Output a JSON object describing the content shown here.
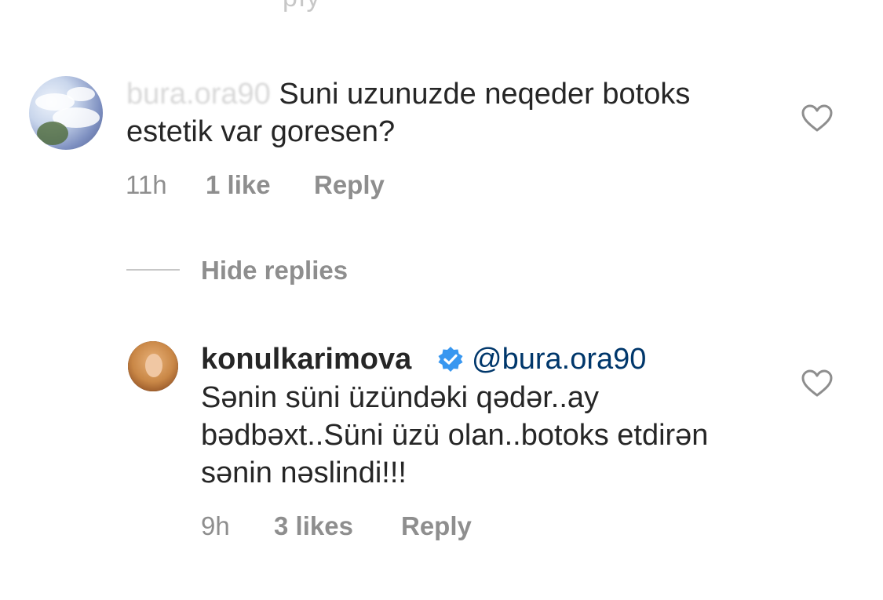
{
  "top_remnant": "ply",
  "comment": {
    "username": "bura.ora90",
    "text": "Suni uzunuzde neqeder botoks estetik var goresen?",
    "time": "11h",
    "likes": "1 like",
    "reply_label": "Reply"
  },
  "hide_replies_label": "Hide replies",
  "reply": {
    "username": "konulkarimova",
    "mention": "@bura.ora90",
    "text": "Sənin süni üzündəki qədər..ay bədbəxt..Süni üzü olan..botoks etdirən sənin nəslindi!!!",
    "time": "9h",
    "likes": "3 likes",
    "reply_label": "Reply"
  },
  "icons": {
    "like": "heart-icon",
    "verified": "verified-badge-icon"
  },
  "colors": {
    "verified": "#3897f0",
    "mention": "#00376b",
    "meta": "#8e8e8e"
  }
}
